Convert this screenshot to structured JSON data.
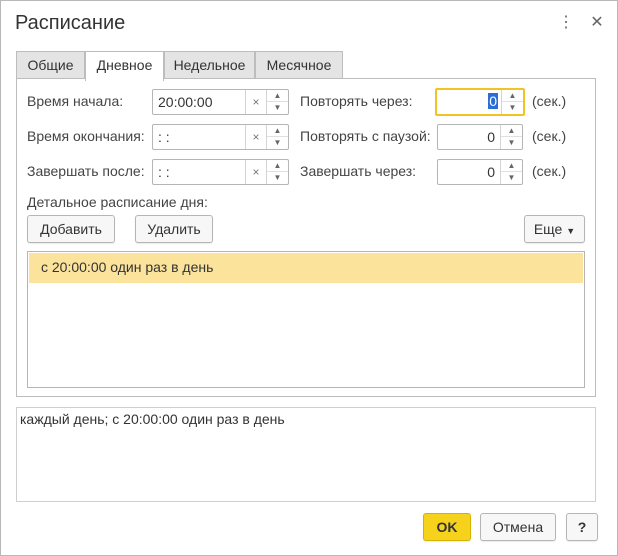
{
  "dialog": {
    "title": "Расписание"
  },
  "tabs": [
    {
      "label": "Общие"
    },
    {
      "label": "Дневное"
    },
    {
      "label": "Недельное"
    },
    {
      "label": "Месячное"
    }
  ],
  "daily": {
    "start_label": "Время начала:",
    "start_value": "20:00:00",
    "end_label": "Время окончания:",
    "end_value": " :  :",
    "finish_after_label": "Завершать после:",
    "finish_after_value": " :  :",
    "repeat_label": "Повторять через:",
    "repeat_value": "0",
    "repeat_pause_label": "Повторять с паузой:",
    "repeat_pause_value": "0",
    "finish_in_label": "Завершать через:",
    "finish_in_value": "0",
    "unit": "(сек.)",
    "detail_label": "Детальное расписание дня:",
    "add_button": "Добавить",
    "delete_button": "Удалить",
    "more_button": "Еще",
    "list": [
      "с 20:00:00 один раз в день"
    ]
  },
  "summary": "каждый день; с 20:00:00 один раз в день",
  "footer": {
    "ok": "OK",
    "cancel": "Отмена",
    "help": "?"
  }
}
